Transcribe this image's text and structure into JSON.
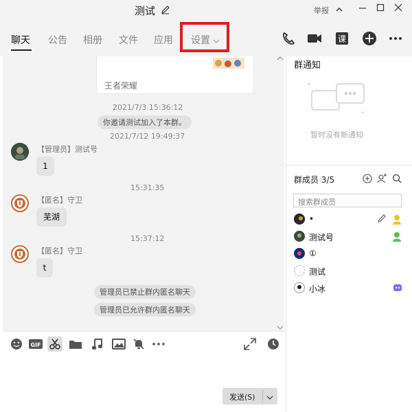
{
  "window": {
    "title": "测试",
    "report": "举报"
  },
  "tabs": [
    {
      "label": "聊天"
    },
    {
      "label": "公告"
    },
    {
      "label": "相册"
    },
    {
      "label": "文件"
    },
    {
      "label": "应用"
    },
    {
      "label": "设置"
    }
  ],
  "chat": {
    "card_title": "王者荣耀",
    "times": [
      "2021/7/3 15:36:12",
      "2021/7/12 19:49:37",
      "15:31:35",
      "15:37:12"
    ],
    "system_messages": [
      "你邀请测试加入了本群。",
      "管理员已禁止群内匿名聊天",
      "管理员已允许群内匿名聊天"
    ],
    "messages": [
      {
        "sender": "【管理员】测试号",
        "text": "1"
      },
      {
        "sender": "【匿名】守卫",
        "text": "芜湖"
      },
      {
        "sender": "【匿名】守卫",
        "text": "t"
      }
    ]
  },
  "input": {
    "send_label": "发送(S)"
  },
  "notice": {
    "title": "群通知",
    "empty": "暂时没有新通知"
  },
  "members": {
    "title": "群成员 3/5",
    "search_placeholder": "搜索群成员",
    "list": [
      {
        "name": "•"
      },
      {
        "name": "测试号"
      },
      {
        "name": "①"
      },
      {
        "name": "测试"
      },
      {
        "name": "小冰"
      }
    ]
  },
  "colors": {
    "highlight": "#e21d1d",
    "bubble": "#e4e4e4",
    "panel_bg": "#f3f3f3"
  }
}
